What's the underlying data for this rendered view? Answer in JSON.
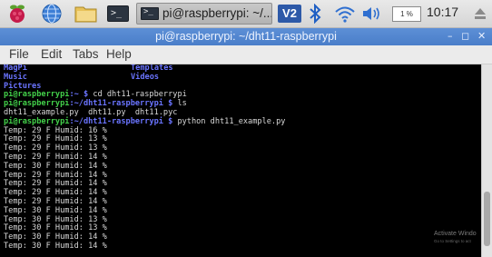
{
  "taskbar": {
    "task_button_label": "pi@raspberrypi: ~/...",
    "vnc_label": "V2",
    "cpu_label": "1 %",
    "clock": "10:17"
  },
  "window": {
    "title": "pi@raspberrypi: ~/dht11-raspberrypi"
  },
  "menubar": {
    "items": [
      "File",
      "Edit",
      "Tabs",
      "Help"
    ]
  },
  "terminal": {
    "listing": [
      {
        "left": "MagPi",
        "right": "Templates"
      },
      {
        "left": "Music",
        "right": "Videos"
      },
      {
        "left": "Pictures",
        "right": ""
      }
    ],
    "commands": [
      {
        "user": "pi@raspberrypi",
        "path": ":~ $",
        "cmd": " cd dht11-raspberrypi"
      },
      {
        "user": "pi@raspberrypi",
        "path": ":~/dht11-raspberrypi $",
        "cmd": " ls"
      },
      {
        "output": "dht11_example.py  dht11.py  dht11.pyc"
      },
      {
        "user": "pi@raspberrypi",
        "path": ":~/dht11-raspberrypi $",
        "cmd": " python dht11_example.py"
      }
    ],
    "readings": [
      "Temp: 29 F Humid: 16 %",
      "Temp: 29 F Humid: 13 %",
      "Temp: 29 F Humid: 13 %",
      "Temp: 29 F Humid: 14 %",
      "Temp: 30 F Humid: 14 %",
      "Temp: 29 F Humid: 14 %",
      "Temp: 29 F Humid: 14 %",
      "Temp: 29 F Humid: 14 %",
      "Temp: 29 F Humid: 14 %",
      "Temp: 30 F Humid: 14 %",
      "Temp: 30 F Humid: 13 %",
      "Temp: 30 F Humid: 13 %",
      "Temp: 30 F Humid: 14 %",
      "Temp: 30 F Humid: 14 %"
    ]
  },
  "watermark": {
    "title": "Activate Windo",
    "sub": "Go to Settings to act"
  }
}
